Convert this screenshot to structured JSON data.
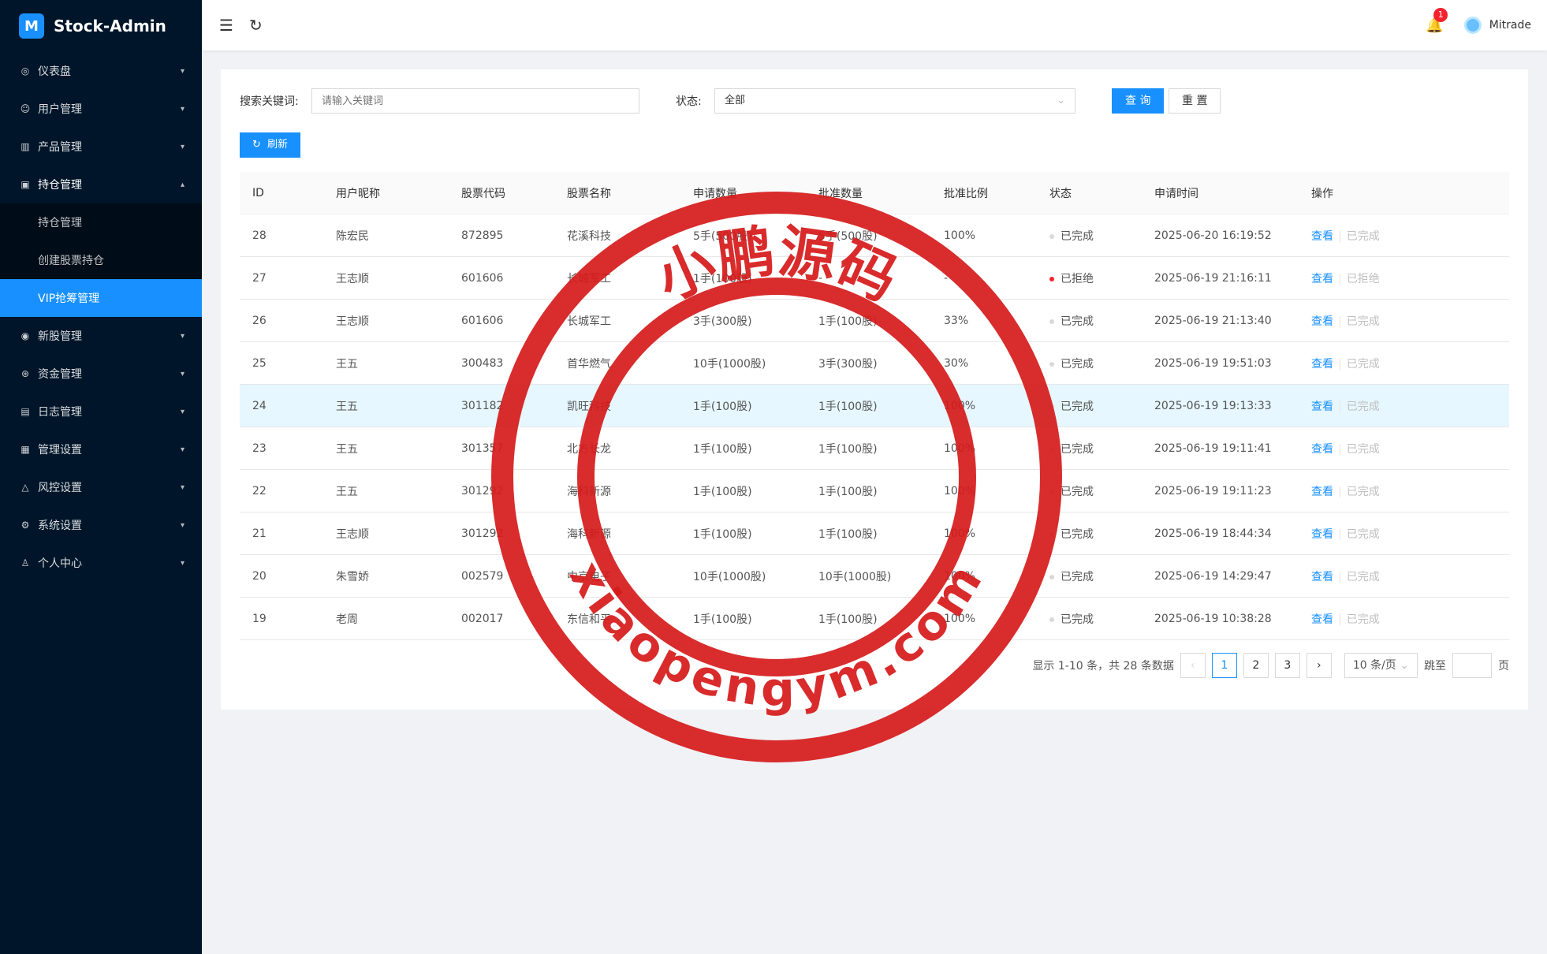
{
  "app": {
    "logo_glyph": "M",
    "title": "Stock-Admin"
  },
  "sidebar": {
    "items": [
      {
        "icon": "dashboard-icon",
        "glyph": "◎",
        "label": "仪表盘"
      },
      {
        "icon": "user-icon",
        "glyph": "☺",
        "label": "用户管理"
      },
      {
        "icon": "product-icon",
        "glyph": "▥",
        "label": "产品管理"
      },
      {
        "icon": "position-icon",
        "glyph": "▣",
        "label": "持仓管理"
      },
      {
        "icon": "newstock-icon",
        "glyph": "◉",
        "label": "新股管理"
      },
      {
        "icon": "fund-icon",
        "glyph": "⊛",
        "label": "资金管理"
      },
      {
        "icon": "log-icon",
        "glyph": "▤",
        "label": "日志管理"
      },
      {
        "icon": "admin-settings-icon",
        "glyph": "▦",
        "label": "管理设置"
      },
      {
        "icon": "risk-icon",
        "glyph": "△",
        "label": "风控设置"
      },
      {
        "icon": "system-settings-icon",
        "glyph": "⚙",
        "label": "系统设置"
      },
      {
        "icon": "personal-icon",
        "glyph": "♙",
        "label": "个人中心"
      }
    ],
    "submenu": [
      "持仓管理",
      "创建股票持仓",
      "VIP抢筹管理"
    ]
  },
  "header": {
    "notifications": "1",
    "username": "Mitrade"
  },
  "search": {
    "keyword_label": "搜索关键词:",
    "keyword_placeholder": "请输入关键词",
    "status_label": "状态:",
    "status_value": "全部",
    "query_label": "查 询",
    "reset_label": "重 置",
    "refresh_label": "刷新"
  },
  "table": {
    "columns": [
      "ID",
      "用户昵称",
      "股票代码",
      "股票名称",
      "申请数量",
      "批准数量",
      "批准比例",
      "状态",
      "申请时间",
      "操作"
    ],
    "view_label": "查看",
    "rows": [
      {
        "id": "28",
        "nick": "陈宏民",
        "code": "872895",
        "name": "花溪科技",
        "apply": "5手(500股)",
        "approve": "5手(500股)",
        "ratio": "100%",
        "status": "已完成",
        "status_color": "gray",
        "time": "2025-06-20 16:19:52",
        "op_status": "已完成"
      },
      {
        "id": "27",
        "nick": "王志顺",
        "code": "601606",
        "name": "长城军工",
        "apply": "1手(100股)",
        "approve": "-",
        "ratio": "-",
        "status": "已拒绝",
        "status_color": "red",
        "time": "2025-06-19 21:16:11",
        "op_status": "已拒绝"
      },
      {
        "id": "26",
        "nick": "王志顺",
        "code": "601606",
        "name": "长城军工",
        "apply": "3手(300股)",
        "approve": "1手(100股)",
        "ratio": "33%",
        "status": "已完成",
        "status_color": "gray",
        "time": "2025-06-19 21:13:40",
        "op_status": "已完成"
      },
      {
        "id": "25",
        "nick": "王五",
        "code": "300483",
        "name": "首华燃气",
        "apply": "10手(1000股)",
        "approve": "3手(300股)",
        "ratio": "30%",
        "status": "已完成",
        "status_color": "gray",
        "time": "2025-06-19 19:51:03",
        "op_status": "已完成"
      },
      {
        "id": "24",
        "nick": "王五",
        "code": "301182",
        "name": "凯旺科技",
        "apply": "1手(100股)",
        "approve": "1手(100股)",
        "ratio": "100%",
        "status": "已完成",
        "status_color": "gray",
        "time": "2025-06-19 19:13:33",
        "op_status": "已完成"
      },
      {
        "id": "23",
        "nick": "王五",
        "code": "301357",
        "name": "北方长龙",
        "apply": "1手(100股)",
        "approve": "1手(100股)",
        "ratio": "100%",
        "status": "已完成",
        "status_color": "gray",
        "time": "2025-06-19 19:11:41",
        "op_status": "已完成"
      },
      {
        "id": "22",
        "nick": "王五",
        "code": "301292",
        "name": "海科新源",
        "apply": "1手(100股)",
        "approve": "1手(100股)",
        "ratio": "100%",
        "status": "已完成",
        "status_color": "gray",
        "time": "2025-06-19 19:11:23",
        "op_status": "已完成"
      },
      {
        "id": "21",
        "nick": "王志顺",
        "code": "301292",
        "name": "海科新源",
        "apply": "1手(100股)",
        "approve": "1手(100股)",
        "ratio": "100%",
        "status": "已完成",
        "status_color": "gray",
        "time": "2025-06-19 18:44:34",
        "op_status": "已完成"
      },
      {
        "id": "20",
        "nick": "朱雪娇",
        "code": "002579",
        "name": "中京电子",
        "apply": "10手(1000股)",
        "approve": "10手(1000股)",
        "ratio": "100%",
        "status": "已完成",
        "status_color": "gray",
        "time": "2025-06-19 14:29:47",
        "op_status": "已完成"
      },
      {
        "id": "19",
        "nick": "老周",
        "code": "002017",
        "name": "东信和平",
        "apply": "1手(100股)",
        "approve": "1手(100股)",
        "ratio": "100%",
        "status": "已完成",
        "status_color": "gray",
        "time": "2025-06-19 10:38:28",
        "op_status": "已完成"
      }
    ]
  },
  "pagination": {
    "summary": "显示 1-10 条，共 28 条数据",
    "pages": [
      "1",
      "2",
      "3"
    ],
    "active_page": "1",
    "page_size": "10 条/页",
    "jump_label": "跳至",
    "page_unit": "页"
  },
  "watermark": {
    "top_text": "小鹏源码",
    "bottom_text": "xiaopengym.com",
    "color": "#d61a1a"
  }
}
